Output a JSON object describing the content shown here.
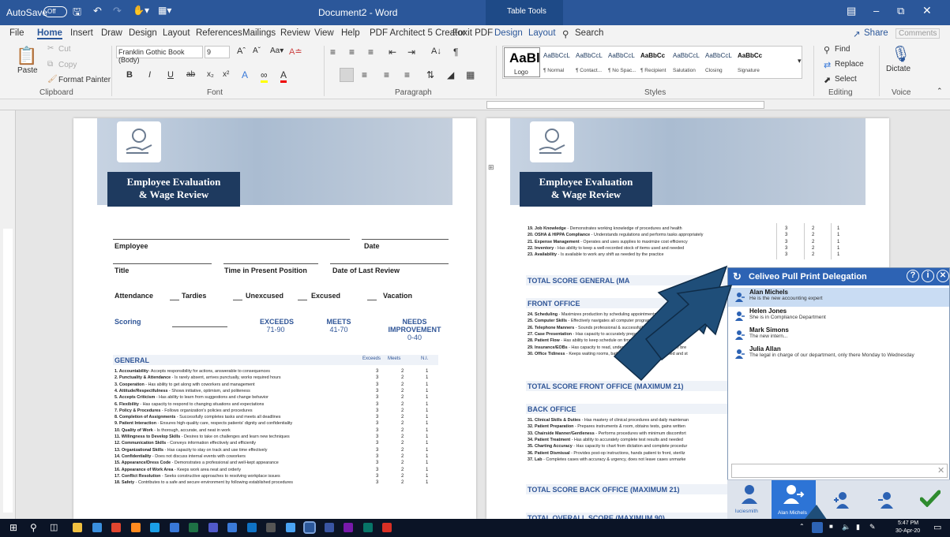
{
  "titlebar": {
    "autosave": "AutoSave",
    "autosave_state": "Off",
    "doc_title": "Document2 - Word",
    "table_tools": "Table Tools"
  },
  "tabs": [
    "File",
    "Home",
    "Insert",
    "Draw",
    "Design",
    "Layout",
    "References",
    "Mailings",
    "Review",
    "View",
    "Help",
    "PDF Architect 5 Creator",
    "Foxit PDF",
    "Design",
    "Layout"
  ],
  "search_label": "Search",
  "share_label": "Share",
  "comments_label": "Comments",
  "ribbon": {
    "clipboard": {
      "paste": "Paste",
      "cut": "Cut",
      "copy": "Copy",
      "format_painter": "Format Painter",
      "label": "Clipboard"
    },
    "font": {
      "family": "Franklin Gothic Book (Body)",
      "size": "9",
      "label": "Font"
    },
    "paragraph": {
      "label": "Paragraph"
    },
    "styles": {
      "big": "AaBl",
      "label": "Styles",
      "items": [
        {
          "preview": "AaBbCcL",
          "name": "Logo"
        },
        {
          "preview": "AaBbCcL",
          "name": "¶ Normal"
        },
        {
          "preview": "AaBbCcL",
          "name": "¶ Contact..."
        },
        {
          "preview": "AaBbCcL",
          "name": "¶ No Spac..."
        },
        {
          "preview": "AaBbCc",
          "name": "¶ Recipient"
        },
        {
          "preview": "AaBbCcL",
          "name": "Salutation"
        },
        {
          "preview": "AaBbCcL",
          "name": "Closing"
        },
        {
          "preview": "AaBbCc",
          "name": "Signature"
        }
      ]
    },
    "editing": {
      "find": "Find",
      "replace": "Replace",
      "select": "Select",
      "label": "Editing"
    },
    "voice": {
      "dictate": "Dictate",
      "label": "Voice"
    }
  },
  "page1": {
    "title1": "Employee Evaluation",
    "title2": "& Wage Review",
    "employee": "Employee",
    "date": "Date",
    "title": "Title",
    "time_in_position": "Time in Present Position",
    "date_last_review": "Date of Last Review",
    "attendance": "Attendance",
    "tardies": "Tardies",
    "unexcused": "Unexcused",
    "excused": "Excused",
    "vacation": "Vacation",
    "scoring": "Scoring",
    "exceeds": "EXCEEDS",
    "exceeds_range": "71-90",
    "meets": "MEETS",
    "meets_range": "41-70",
    "needs": "NEEDS",
    "improvement": "IMPROVEMENT",
    "needs_range": "0-40",
    "general": "GENERAL",
    "col_exceeds": "Exceeds",
    "col_meets": "Meets",
    "col_ni": "N.I.",
    "items": [
      {
        "b": "1. Accountability",
        "t": "- Accepts responsibility for actions, answerable to consequences"
      },
      {
        "b": "2. Punctuality & Attendance",
        "t": " - Is rarely absent, arrives punctually, works required hours"
      },
      {
        "b": "3. Cooperation",
        "t": " - Has ability to get along with coworkers and management"
      },
      {
        "b": "4. Attitude/Respectfulness",
        "t": " - Shows initiative, optimism, and politeness"
      },
      {
        "b": "5. Accepts Criticism",
        "t": " - Has ability to learn from suggestions and change behavior"
      },
      {
        "b": "6. Flexibility",
        "t": " - Has capacity to respond to changing situations and expectations"
      },
      {
        "b": "7. Policy & Procedures",
        "t": " - Follows organization's policies and procedures"
      },
      {
        "b": "8. Completion of Assignments",
        "t": " - Successfully completes tasks and meets all deadlines"
      },
      {
        "b": "9. Patient Interaction",
        "t": " - Ensures high-quality care, respects patients' dignity and confidentiality"
      },
      {
        "b": "10. Quality of Work",
        "t": " - Is thorough, accurate, and neat in work"
      },
      {
        "b": "11. Willingness to Develop Skills",
        "t": " - Desires to take on challenges and learn new techniques"
      },
      {
        "b": "12. Communication Skills",
        "t": " - Conveys information effectively and efficiently"
      },
      {
        "b": "13. Organizational Skills",
        "t": " - Has capacity to stay on track and use time effectively"
      },
      {
        "b": "14. Confidentiality",
        "t": " - Does not discuss internal events with coworkers"
      },
      {
        "b": "15. Appearance/Dress Code",
        "t": " - Demonstrates a professional and well-kept appearance"
      },
      {
        "b": "16. Appearance of Work Area",
        "t": " - Keeps work area neat and orderly"
      },
      {
        "b": "17. Conflict Resolution",
        "t": " - Seeks constructive approaches to resolving workplace issues"
      },
      {
        "b": "18. Safety",
        "t": " - Contributes to a safe and secure environment by following established procedures"
      }
    ],
    "scores": [
      "3",
      "2",
      "1"
    ]
  },
  "page2": {
    "title1": "Employee Evaluation",
    "title2": "& Wage Review",
    "items_top": [
      {
        "b": "19. Job Knowledge",
        "t": " - Demonstrates working knowledge of procedures and health"
      },
      {
        "b": "20. OSHA & HIPPA Compliance",
        "t": " - Understands regulations and performs tasks appropriately"
      },
      {
        "b": "21. Expense Management",
        "t": " - Operates and uses supplies to maximize cost efficiency"
      },
      {
        "b": "22. Inventory",
        "t": " - Has ability to keep a well-recorded stock of items used and needed"
      },
      {
        "b": "23. Availability",
        "t": " - Is available to work any shift as needed by the practice"
      }
    ],
    "total_general": "TOTAL SCORE GENERAL (MA",
    "front_office": "FRONT OFFICE",
    "items_front": [
      {
        "b": "24. Scheduling",
        "t": " - Maximizes production by scheduling appointments"
      },
      {
        "b": "25. Computer Skills",
        "t": " - Effectively navigates all computer programs necessary to comp"
      },
      {
        "b": "26. Telephone Manners",
        "t": " - Sounds professional & successfully uses supplied scripts"
      },
      {
        "b": "27. Case Presentation",
        "t": " - Has capacity to accurately prepare and effectively present"
      },
      {
        "b": "28. Patient Flow",
        "t": " - Has ability to keep schedule on time and limit patient waiting time"
      },
      {
        "b": "29. Insurance/EOBs",
        "t": " - Has capacity to read, understand, and process insurance bre"
      },
      {
        "b": "30. Office Tidiness",
        "t": " - Keeps waiting rooms, bathrooms, & break room cleaned and st"
      }
    ],
    "total_front": "TOTAL SCORE FRONT OFFICE (MAXIMUM 21)",
    "back_office": "BACK OFFICE",
    "items_back": [
      {
        "b": "31. Clinical Skills & Duties",
        "t": " - Has mastery of clinical procedures and daily maintenan"
      },
      {
        "b": "32. Patient Preparation",
        "t": " - Prepares instruments & room, obtains tests, gains written"
      },
      {
        "b": "33. Chairside Manner/Gentleness",
        "t": " - Performs procedures with minimum discomfort"
      },
      {
        "b": "34. Patient Treatment",
        "t": " - Has ability to accurately complete test results and needed"
      },
      {
        "b": "35. Charting Accuracy",
        "t": " - Has capacity to chart from dictation and complete procedur"
      },
      {
        "b": "36. Patient Dismissal",
        "t": " - Provides post-op instructions, hands patient to front, steriliz"
      },
      {
        "b": "37. Lab",
        "t": " - Completes cases with accuracy & urgency, does not leave cases unmarke"
      }
    ],
    "total_back": "TOTAL SCORE BACK OFFICE (MAXIMUM 21)",
    "total_overall": "TOTAL OVERALL SCORE (MAXIMUM 90)"
  },
  "panel": {
    "title": "Celiveo Pull Print Delegation",
    "entries": [
      {
        "name": "Alan Michels",
        "desc": "He is the new accounting expert"
      },
      {
        "name": "Helen Jones",
        "desc": "She is in Compliance Department"
      },
      {
        "name": "Mark Simons",
        "desc": "The new intern..."
      },
      {
        "name": "Julia Allan",
        "desc": "The legal in charge of our department, only there Monday to Wednesday"
      }
    ],
    "search_value": "",
    "footer_user": "luciesmith",
    "footer_selected": "Alan Michels"
  },
  "taskbar": {
    "time": "5:47 PM",
    "date": "30-Apr-20"
  },
  "colors": {
    "word_blue": "#2b579a",
    "navy": "#1e3a5f",
    "panel_blue": "#2d63b4",
    "arrow": "#1f4e79",
    "check": "#2e8b2e"
  }
}
